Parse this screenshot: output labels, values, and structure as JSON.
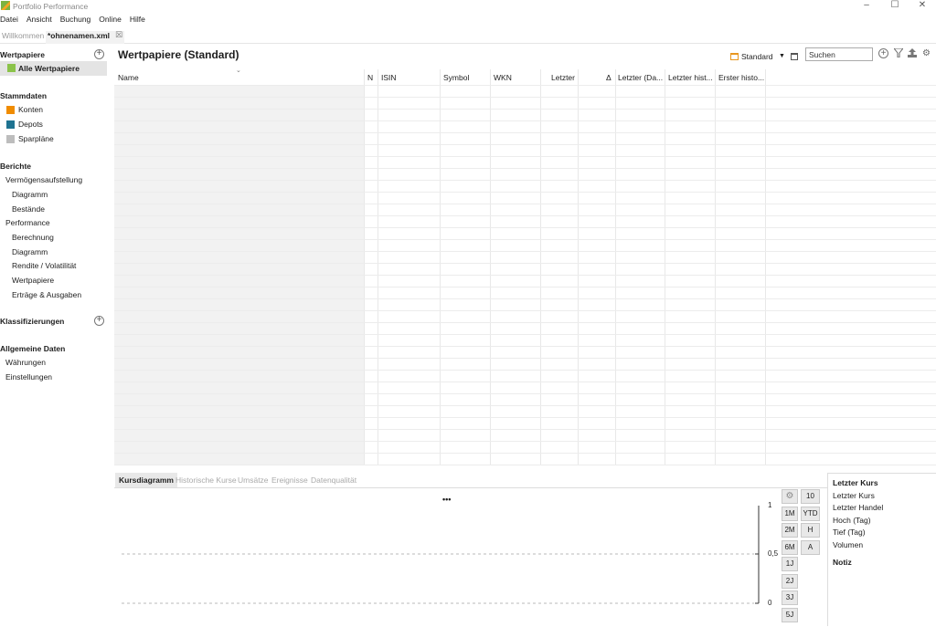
{
  "window": {
    "title": "Portfolio Performance",
    "minimize": "–",
    "maximize": "☐",
    "close": "✕"
  },
  "menu": [
    "Datei",
    "Ansicht",
    "Buchung",
    "Online",
    "Hilfe"
  ],
  "editor_tabs": {
    "welcome": "Willkommen",
    "file": "*ohnenamen.xml",
    "close_glyph": "☒"
  },
  "sidebar": {
    "wertpapiere": {
      "title": "Wertpapiere",
      "selected": "Alle Wertpapiere"
    },
    "stammdaten": {
      "title": "Stammdaten",
      "items": [
        "Konten",
        "Depots",
        "Sparpläne"
      ],
      "colors": [
        "#f08c00",
        "#1f7391",
        "#bdbdbd"
      ]
    },
    "berichte": {
      "title": "Berichte",
      "groups": [
        {
          "label": "Vermögensaufstellung",
          "items": [
            "Diagramm",
            "Bestände"
          ]
        },
        {
          "label": "Performance",
          "items": [
            "Berechnung",
            "Diagramm",
            "Rendite / Volatilität",
            "Wertpapiere",
            "Erträge & Ausgaben"
          ]
        }
      ]
    },
    "klassifizierungen": {
      "title": "Klassifizierungen"
    },
    "allgemein": {
      "title": "Allgemeine Daten",
      "items": [
        "Währungen",
        "Einstellungen"
      ]
    }
  },
  "main": {
    "title": "Wertpapiere (Standard)",
    "view_label": "Standard",
    "search_placeholder": "Suchen",
    "columns": [
      "Name",
      "N",
      "ISIN",
      "Symbol",
      "WKN",
      "Letzter",
      "Δ",
      "Letzter (Da...",
      "Letzter hist...",
      "Erster histo..."
    ]
  },
  "bottom": {
    "tabs": [
      "Kursdiagramm",
      "Historische Kurse",
      "Umsätze",
      "Ereignisse",
      "Datenqualität"
    ],
    "active_tab": "Kursdiagramm",
    "chart_menu": "•••",
    "axis_ticks": [
      "1",
      "0,5",
      "0"
    ],
    "range_buttons_left": [
      "1M",
      "2M",
      "6M",
      "1J",
      "2J",
      "3J",
      "5J"
    ],
    "range_buttons_right": [
      "10",
      "YTD",
      "H",
      "A"
    ]
  },
  "info_panel": {
    "title": "Letzter Kurs",
    "rows": [
      "Letzter Kurs",
      "Letzter Handel",
      "Hoch (Tag)",
      "Tief (Tag)",
      "Volumen"
    ],
    "note_title": "Notiz"
  }
}
